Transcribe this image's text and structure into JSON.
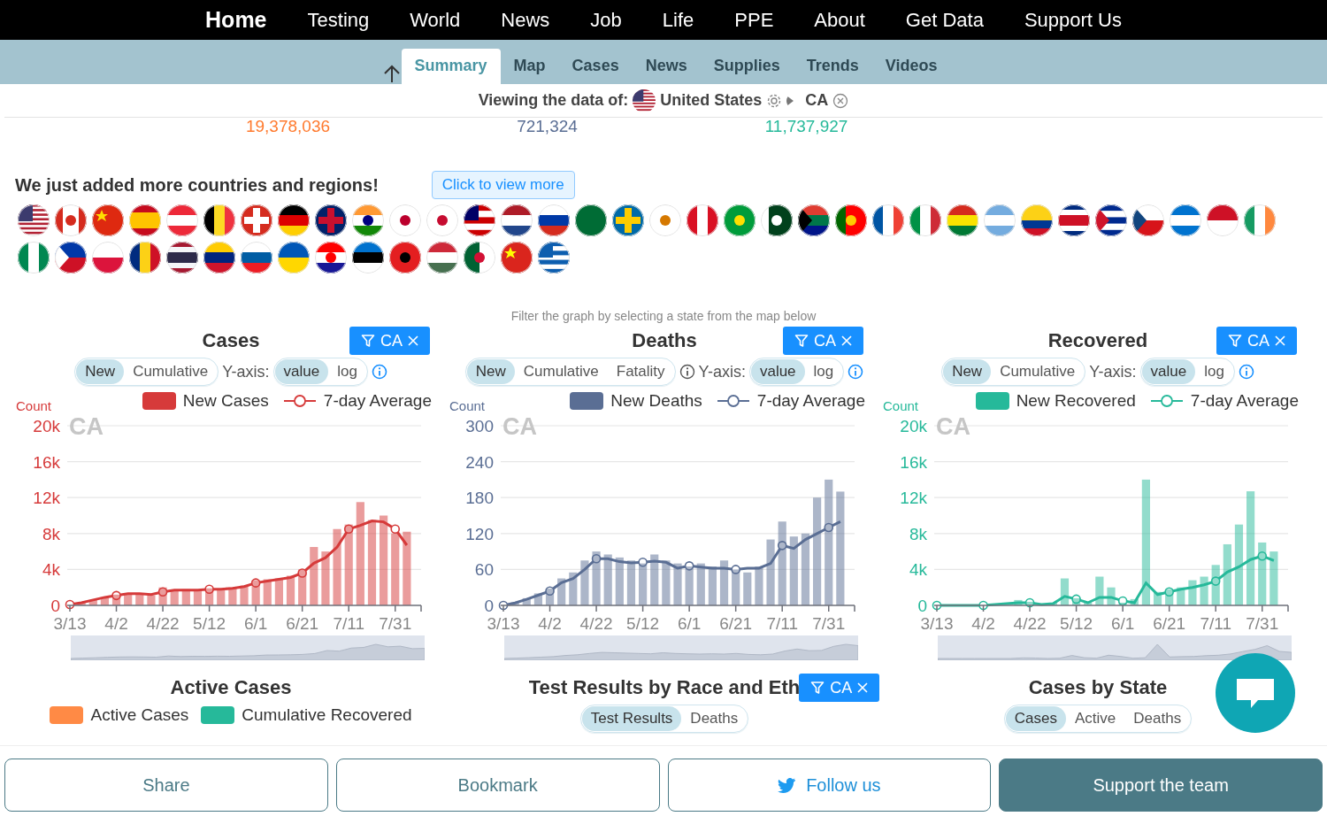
{
  "nav": {
    "items": [
      {
        "label": "Home",
        "selected": true
      },
      {
        "label": "Testing",
        "selected": false
      },
      {
        "label": "World",
        "selected": false
      },
      {
        "label": "News",
        "selected": false
      },
      {
        "label": "Job",
        "selected": false
      },
      {
        "label": "Life",
        "selected": false
      },
      {
        "label": "PPE",
        "selected": false
      },
      {
        "label": "About",
        "selected": false
      },
      {
        "label": "Get Data",
        "selected": false
      },
      {
        "label": "Support Us",
        "selected": false
      }
    ]
  },
  "subnav": {
    "tabs": [
      {
        "label": "Summary",
        "selected": true
      },
      {
        "label": "Map",
        "selected": false
      },
      {
        "label": "Cases",
        "selected": false
      },
      {
        "label": "News",
        "selected": false
      },
      {
        "label": "Supplies",
        "selected": false
      },
      {
        "label": "Trends",
        "selected": false
      },
      {
        "label": "Videos",
        "selected": false
      }
    ]
  },
  "viewing": {
    "label": "Viewing the data of:",
    "country": "United States",
    "region": "CA"
  },
  "stats": [
    {
      "value": "19,378,036",
      "color": "#ff7a2e"
    },
    {
      "value": "721,324",
      "color": "#5a6e94"
    },
    {
      "value": "11,737,927",
      "color": "#26b99a"
    }
  ],
  "announcement": {
    "text": "We just added more countries and regions!",
    "button": "Click to view more"
  },
  "charts_note": "Filter the graph by selecting a state from the map below",
  "charts": [
    {
      "filter": "CA",
      "modes": [
        {
          "label": "New",
          "selected": true
        },
        {
          "label": "Cumulative",
          "selected": false
        }
      ],
      "modes_info": false,
      "yaxis_label": "Y-axis:",
      "scales": [
        {
          "label": "value",
          "selected": true
        },
        {
          "label": "log",
          "selected": false
        }
      ],
      "chart_data": {
        "type": "bar",
        "grid": true,
        "title": "Cases",
        "ylabel": "Count",
        "annotations": [
          "CA"
        ],
        "categories": [
          "3/13",
          null,
          null,
          null,
          "4/2",
          null,
          null,
          null,
          "4/22",
          null,
          null,
          null,
          "5/12",
          null,
          null,
          null,
          "6/1",
          null,
          null,
          null,
          "6/21",
          null,
          null,
          null,
          "7/11",
          null,
          null,
          null,
          "7/31",
          null
        ],
        "series": [
          {
            "name": "New Cases",
            "type": "bar",
            "color": "#d63a3a",
            "values": [
              0,
              300,
              600,
              900,
              1200,
              1300,
              1200,
              1100,
              2000,
              1600,
              1800,
              1700,
              1900,
              1800,
              2000,
              2200,
              2800,
              2900,
              3000,
              3300,
              4000,
              6500,
              6000,
              8500,
              9000,
              11500,
              9500,
              10000,
              8000,
              8200
            ]
          },
          {
            "name": "7-day Average",
            "type": "line",
            "color": "#d63a3a",
            "values": [
              100,
              300,
              600,
              900,
              1100,
              1300,
              1300,
              1200,
              1500,
              1700,
              1700,
              1700,
              1800,
              1800,
              1900,
              2100,
              2500,
              2700,
              2900,
              3100,
              3600,
              4700,
              5300,
              6500,
              8500,
              8900,
              9400,
              9300,
              8500,
              6700
            ]
          }
        ],
        "ylim": [
          0,
          20000
        ],
        "yticks": [
          {
            "value": 0,
            "label": "0"
          },
          {
            "value": 4000,
            "label": "4k"
          },
          {
            "value": 8000,
            "label": "8k"
          },
          {
            "value": 12000,
            "label": "12k"
          },
          {
            "value": 16000,
            "label": "16k"
          },
          {
            "value": 20000,
            "label": "20k"
          }
        ]
      }
    },
    {
      "filter": "CA",
      "modes": [
        {
          "label": "New",
          "selected": true
        },
        {
          "label": "Cumulative",
          "selected": false
        },
        {
          "label": "Fatality",
          "selected": false
        }
      ],
      "modes_info": true,
      "yaxis_label": "Y-axis:",
      "scales": [
        {
          "label": "value",
          "selected": true
        },
        {
          "label": "log",
          "selected": false
        }
      ],
      "chart_data": {
        "type": "bar",
        "grid": true,
        "title": "Deaths",
        "ylabel": "Count",
        "annotations": [
          "CA"
        ],
        "categories": [
          "3/13",
          null,
          null,
          null,
          "4/2",
          null,
          null,
          null,
          "4/22",
          null,
          null,
          null,
          "5/12",
          null,
          null,
          null,
          "6/1",
          null,
          null,
          null,
          "6/21",
          null,
          null,
          null,
          "7/11",
          null,
          null,
          null,
          "7/31",
          null
        ],
        "series": [
          {
            "name": "New Deaths",
            "type": "bar",
            "color": "#5a6e94",
            "values": [
              0,
              5,
              12,
              20,
              28,
              45,
              55,
              75,
              90,
              85,
              80,
              75,
              70,
              85,
              75,
              70,
              65,
              70,
              65,
              75,
              60,
              55,
              65,
              110,
              140,
              115,
              120,
              180,
              210,
              190
            ]
          },
          {
            "name": "7-day Average",
            "type": "line",
            "color": "#5a6e94",
            "values": [
              0,
              4,
              10,
              17,
              24,
              38,
              45,
              60,
              78,
              78,
              73,
              71,
              72,
              74,
              72,
              62,
              66,
              64,
              62,
              62,
              60,
              62,
              62,
              70,
              100,
              95,
              110,
              120,
              130,
              140
            ]
          }
        ],
        "ylim": [
          0,
          300
        ],
        "yticks": [
          {
            "value": 0,
            "label": "0"
          },
          {
            "value": 60,
            "label": "60"
          },
          {
            "value": 120,
            "label": "120"
          },
          {
            "value": 180,
            "label": "180"
          },
          {
            "value": 240,
            "label": "240"
          },
          {
            "value": 300,
            "label": "300"
          }
        ]
      }
    },
    {
      "filter": "CA",
      "modes": [
        {
          "label": "New",
          "selected": true
        },
        {
          "label": "Cumulative",
          "selected": false
        }
      ],
      "modes_info": false,
      "yaxis_label": "Y-axis:",
      "scales": [
        {
          "label": "value",
          "selected": true
        },
        {
          "label": "log",
          "selected": false
        }
      ],
      "chart_data": {
        "type": "bar",
        "grid": true,
        "title": "Recovered",
        "ylabel": "Count",
        "annotations": [
          "CA"
        ],
        "categories": [
          "3/13",
          null,
          null,
          null,
          "4/2",
          null,
          null,
          null,
          "4/22",
          null,
          null,
          null,
          "5/12",
          null,
          null,
          null,
          "6/1",
          null,
          null,
          null,
          "6/21",
          null,
          null,
          null,
          "7/11",
          null,
          null,
          null,
          "7/31",
          null
        ],
        "series": [
          {
            "name": "New Recovered",
            "type": "bar",
            "color": "#26b99a",
            "values": [
              0,
              0,
              0,
              0,
              0,
              0,
              0,
              600,
              400,
              0,
              300,
              3000,
              800,
              300,
              3200,
              2000,
              300,
              700,
              14000,
              1500,
              1800,
              2000,
              2800,
              3200,
              4500,
              6800,
              9000,
              12700,
              7000,
              6000
            ]
          },
          {
            "name": "7-day Average",
            "type": "line",
            "color": "#26b99a",
            "values": [
              0,
              0,
              0,
              0,
              0,
              100,
              200,
              300,
              300,
              100,
              200,
              1000,
              700,
              300,
              900,
              900,
              500,
              300,
              2500,
              1200,
              1500,
              1800,
              2000,
              2300,
              2700,
              3700,
              4300,
              5100,
              5500,
              5000
            ]
          }
        ],
        "ylim": [
          0,
          20000
        ],
        "yticks": [
          {
            "value": 0,
            "label": "0"
          },
          {
            "value": 4000,
            "label": "4k"
          },
          {
            "value": 8000,
            "label": "8k"
          },
          {
            "value": 12000,
            "label": "12k"
          },
          {
            "value": 16000,
            "label": "16k"
          },
          {
            "value": 20000,
            "label": "20k"
          }
        ]
      }
    }
  ],
  "lower": [
    {
      "title": "Active Cases",
      "legend": [
        {
          "label": "Active Cases",
          "color": "#ff8a45"
        },
        {
          "label": "Cumulative Recovered",
          "color": "#26b99a"
        }
      ]
    },
    {
      "title": "Test Results by Race and Eth",
      "filter": "CA",
      "toggles": [
        {
          "label": "Test Results",
          "selected": true
        },
        {
          "label": "Deaths",
          "selected": false
        }
      ]
    },
    {
      "title": "Cases by State",
      "toggles": [
        {
          "label": "Cases",
          "selected": true
        },
        {
          "label": "Active",
          "selected": false
        },
        {
          "label": "Deaths",
          "selected": false
        }
      ]
    }
  ],
  "footer": {
    "buttons": [
      {
        "label": "Share",
        "kind": "outline"
      },
      {
        "label": "Bookmark",
        "kind": "outline"
      },
      {
        "label": "Follow us",
        "kind": "twitter"
      },
      {
        "label": "Support the team",
        "kind": "filled"
      }
    ]
  }
}
